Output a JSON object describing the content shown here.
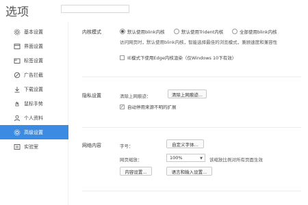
{
  "header": {
    "title": "选项",
    "search_placeholder": ""
  },
  "sidebar": {
    "items": [
      {
        "label": "基本设置",
        "icon": "gear-icon"
      },
      {
        "label": "界面设置",
        "icon": "window-icon"
      },
      {
        "label": "标签设置",
        "icon": "tag-icon"
      },
      {
        "label": "广告拦截",
        "icon": "block-icon"
      },
      {
        "label": "下载设置",
        "icon": "download-icon"
      },
      {
        "label": "鼠标手势",
        "icon": "mouse-icon"
      },
      {
        "label": "个人资料",
        "icon": "person-icon"
      },
      {
        "label": "高级设置",
        "icon": "advanced-icon"
      },
      {
        "label": "实验室",
        "icon": "lab-icon"
      }
    ],
    "active_index": 7
  },
  "kernel": {
    "label": "内核模式",
    "options": [
      {
        "label": "默认使用blink内核",
        "selected": true
      },
      {
        "label": "默认使用Trident内核",
        "selected": false
      },
      {
        "label": "全部使用blink内核",
        "selected": false
      }
    ],
    "description": "访问网页时，默认使用blink内核，智能选择最佳的浏览模式，兼顾速度和兼容性",
    "ie_mode_label": "IE模式下使用Edge内核渲染（仅Windows 10下有效）",
    "ie_mode_checked": false
  },
  "privacy": {
    "label": "隐私设置",
    "clear_label": "清除上网痕迹：",
    "clear_button": "清除上网痕迹...",
    "auto_disable_label": "自动停用来源不明的扩展",
    "auto_disable_checked": true
  },
  "web_content": {
    "label": "网络内容",
    "font_label": "字号：",
    "font_button": "自定义字体...",
    "zoom_label": "网页缩放：",
    "zoom_value": "100%",
    "zoom_hint": "该缩放比例对所有页面生效",
    "content_button": "内容设置...",
    "language_button": "语言和输入设置..."
  },
  "colors": {
    "accent": "#3c8be2"
  }
}
